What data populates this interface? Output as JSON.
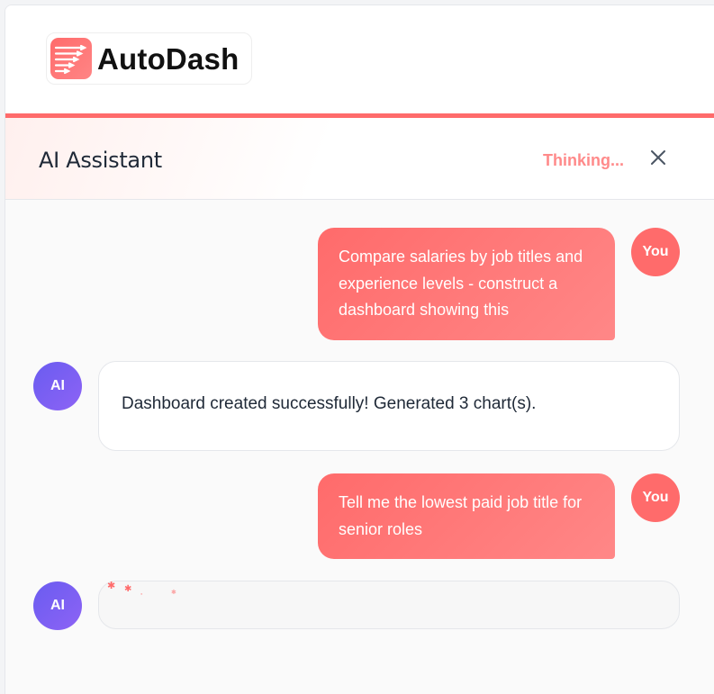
{
  "app": {
    "logo_text": "AutoDash"
  },
  "assistant": {
    "title": "AI Assistant",
    "status": "Thinking...",
    "close_icon": "close-icon"
  },
  "messages": [
    {
      "role": "user",
      "avatar": "You",
      "text": "Compare salaries by job titles and experience levels - construct a dashboard showing this"
    },
    {
      "role": "ai",
      "avatar": "AI",
      "text": "Dashboard created successfully! Generated 3 chart(s)."
    },
    {
      "role": "user",
      "avatar": "You",
      "text": "Tell me the lowest paid job title for senior roles"
    },
    {
      "role": "ai",
      "avatar": "AI",
      "text": ""
    }
  ],
  "colors": {
    "accent": "#ff6b6b",
    "thinking": "#ff8a8a",
    "ai_avatar": "#7a5ff2"
  }
}
